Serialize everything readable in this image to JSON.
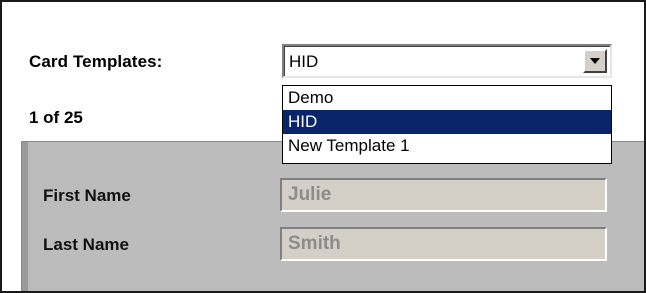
{
  "card_templates": {
    "label": "Card Templates:",
    "selected": "HID",
    "options": [
      "Demo",
      "HID",
      "New Template 1"
    ],
    "selected_index": 1
  },
  "record": {
    "position": "1 of 25"
  },
  "fields": [
    {
      "label": "First Name",
      "value": "Julie"
    },
    {
      "label": "Last Name",
      "value": "Smith"
    }
  ],
  "colors": {
    "selection_highlight": "#0a246a",
    "panel_background": "#bcbcbc",
    "disabled_field_background": "#d4d0c8",
    "disabled_field_text": "#8c8c8c"
  },
  "icons": {
    "dropdown": "chevron-down-icon"
  }
}
